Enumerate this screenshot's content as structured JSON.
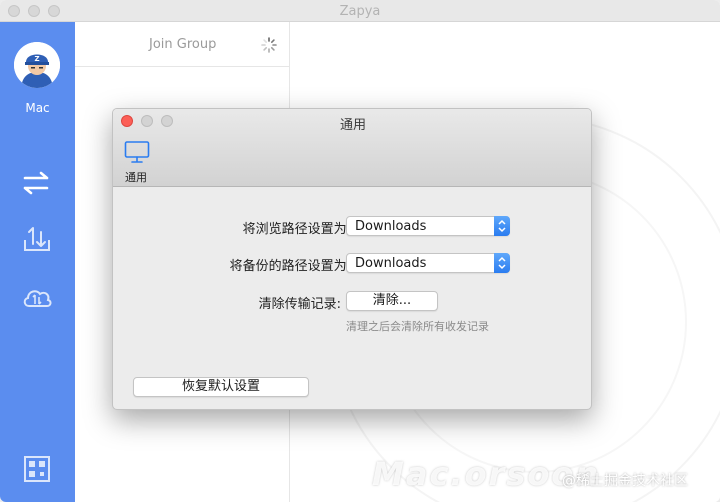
{
  "window": {
    "title": "Zapya"
  },
  "sidebar": {
    "user_name": "Mac"
  },
  "panel": {
    "join_group": "Join Group"
  },
  "dialog": {
    "title": "通用",
    "tab_label": "通用",
    "browse_path_label": "将浏览路径设置为:",
    "browse_path_value": "Downloads",
    "backup_path_label": "将备份的路径设置为:",
    "backup_path_value": "Downloads",
    "clear_history_label": "清除传输记录:",
    "clear_button": "清除...",
    "clear_hint": "清理之后会清除所有收发记录",
    "restore_defaults_button": "恢复默认设置"
  },
  "watermark": {
    "text": "Mac.orsoon",
    "credit": "@稀土掘金技术社区"
  },
  "colors": {
    "sidebar": "#5b8def",
    "accent": "#2a7cf0",
    "close": "#fc5f57"
  }
}
